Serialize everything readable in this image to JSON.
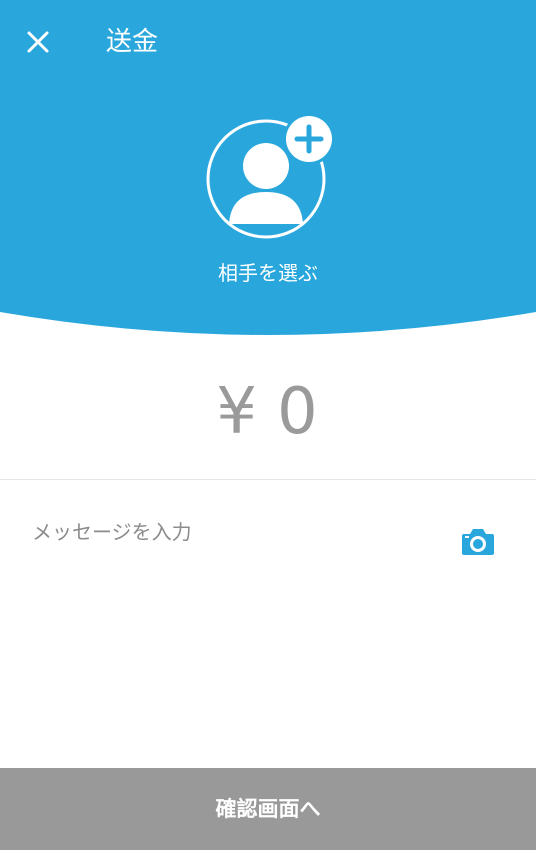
{
  "header": {
    "title": "送金",
    "close_icon": "close-icon",
    "background_color": "#29a7dd"
  },
  "recipient": {
    "label": "相手を選ぶ",
    "avatar_icon": "person-add-icon"
  },
  "amount": {
    "currency": "¥",
    "value": "0"
  },
  "message": {
    "placeholder": "メッセージを入力",
    "value": "",
    "camera_icon": "camera-icon"
  },
  "footer": {
    "confirm_label": "確認画面へ",
    "button_color": "#999999"
  }
}
